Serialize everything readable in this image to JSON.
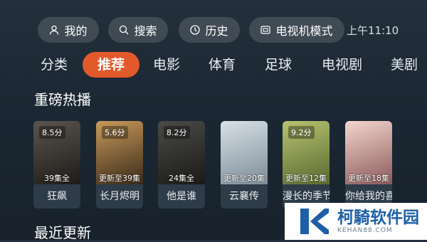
{
  "top_bar": {
    "mine": {
      "label": "我的",
      "icon": "user-icon"
    },
    "search": {
      "label": "搜索",
      "icon": "search-icon"
    },
    "history": {
      "label": "历史",
      "icon": "clock-icon"
    },
    "mode": {
      "label": "电视机模式",
      "icon": "screen-mode-icon"
    },
    "time": "上午11:10"
  },
  "tabs": [
    "分类",
    "推荐",
    "电影",
    "体育",
    "足球",
    "电视剧",
    "美剧"
  ],
  "active_tab": "推荐",
  "sections": {
    "hot": "重磅热播",
    "recent": "最近更新"
  },
  "cards": [
    {
      "title": "狂飙",
      "rating": "8.5分",
      "episodes": "39集全",
      "colors": [
        "#5a5550",
        "#1e1b18"
      ]
    },
    {
      "title": "长月烬明",
      "rating": "5.6分",
      "episodes": "更新至39集",
      "colors": [
        "#c89a5a",
        "#3a2a1a"
      ]
    },
    {
      "title": "他是谁",
      "rating": "8.2分",
      "episodes": "24集全",
      "colors": [
        "#4a4a48",
        "#1a1a18"
      ]
    },
    {
      "title": "云襄传",
      "rating": "",
      "episodes": "更新至20集",
      "colors": [
        "#d8e0e6",
        "#7c8d98"
      ]
    },
    {
      "title": "漫长的季节",
      "rating": "9.2分",
      "episodes": "更新至12集",
      "colors": [
        "#b7c270",
        "#5a6a30"
      ]
    },
    {
      "title": "你给我的喜欢",
      "rating": "",
      "episodes": "更新至18集",
      "colors": [
        "#f4d6cf",
        "#8a5a5a"
      ]
    }
  ],
  "watermark": {
    "name": "柯騎软件园",
    "url": "KEHAN88.COM",
    "color": "#1f5fa8"
  },
  "colors": {
    "accent": "#e25a2b",
    "background": "#1b2732"
  }
}
